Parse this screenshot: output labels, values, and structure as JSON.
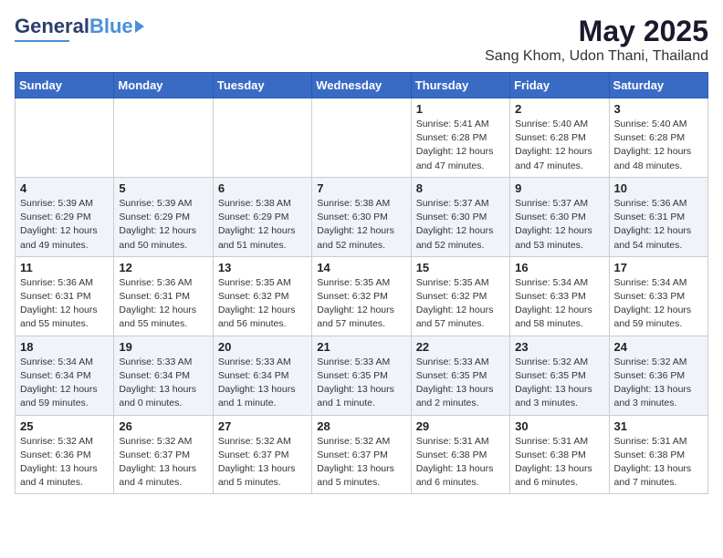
{
  "header": {
    "logo_general": "General",
    "logo_blue": "Blue",
    "title": "May 2025",
    "subtitle": "Sang Khom, Udon Thani, Thailand"
  },
  "weekdays": [
    "Sunday",
    "Monday",
    "Tuesday",
    "Wednesday",
    "Thursday",
    "Friday",
    "Saturday"
  ],
  "weeks": [
    [
      {
        "day": "",
        "info": ""
      },
      {
        "day": "",
        "info": ""
      },
      {
        "day": "",
        "info": ""
      },
      {
        "day": "",
        "info": ""
      },
      {
        "day": "1",
        "info": "Sunrise: 5:41 AM\nSunset: 6:28 PM\nDaylight: 12 hours\nand 47 minutes."
      },
      {
        "day": "2",
        "info": "Sunrise: 5:40 AM\nSunset: 6:28 PM\nDaylight: 12 hours\nand 47 minutes."
      },
      {
        "day": "3",
        "info": "Sunrise: 5:40 AM\nSunset: 6:28 PM\nDaylight: 12 hours\nand 48 minutes."
      }
    ],
    [
      {
        "day": "4",
        "info": "Sunrise: 5:39 AM\nSunset: 6:29 PM\nDaylight: 12 hours\nand 49 minutes."
      },
      {
        "day": "5",
        "info": "Sunrise: 5:39 AM\nSunset: 6:29 PM\nDaylight: 12 hours\nand 50 minutes."
      },
      {
        "day": "6",
        "info": "Sunrise: 5:38 AM\nSunset: 6:29 PM\nDaylight: 12 hours\nand 51 minutes."
      },
      {
        "day": "7",
        "info": "Sunrise: 5:38 AM\nSunset: 6:30 PM\nDaylight: 12 hours\nand 52 minutes."
      },
      {
        "day": "8",
        "info": "Sunrise: 5:37 AM\nSunset: 6:30 PM\nDaylight: 12 hours\nand 52 minutes."
      },
      {
        "day": "9",
        "info": "Sunrise: 5:37 AM\nSunset: 6:30 PM\nDaylight: 12 hours\nand 53 minutes."
      },
      {
        "day": "10",
        "info": "Sunrise: 5:36 AM\nSunset: 6:31 PM\nDaylight: 12 hours\nand 54 minutes."
      }
    ],
    [
      {
        "day": "11",
        "info": "Sunrise: 5:36 AM\nSunset: 6:31 PM\nDaylight: 12 hours\nand 55 minutes."
      },
      {
        "day": "12",
        "info": "Sunrise: 5:36 AM\nSunset: 6:31 PM\nDaylight: 12 hours\nand 55 minutes."
      },
      {
        "day": "13",
        "info": "Sunrise: 5:35 AM\nSunset: 6:32 PM\nDaylight: 12 hours\nand 56 minutes."
      },
      {
        "day": "14",
        "info": "Sunrise: 5:35 AM\nSunset: 6:32 PM\nDaylight: 12 hours\nand 57 minutes."
      },
      {
        "day": "15",
        "info": "Sunrise: 5:35 AM\nSunset: 6:32 PM\nDaylight: 12 hours\nand 57 minutes."
      },
      {
        "day": "16",
        "info": "Sunrise: 5:34 AM\nSunset: 6:33 PM\nDaylight: 12 hours\nand 58 minutes."
      },
      {
        "day": "17",
        "info": "Sunrise: 5:34 AM\nSunset: 6:33 PM\nDaylight: 12 hours\nand 59 minutes."
      }
    ],
    [
      {
        "day": "18",
        "info": "Sunrise: 5:34 AM\nSunset: 6:34 PM\nDaylight: 12 hours\nand 59 minutes."
      },
      {
        "day": "19",
        "info": "Sunrise: 5:33 AM\nSunset: 6:34 PM\nDaylight: 13 hours\nand 0 minutes."
      },
      {
        "day": "20",
        "info": "Sunrise: 5:33 AM\nSunset: 6:34 PM\nDaylight: 13 hours\nand 1 minute."
      },
      {
        "day": "21",
        "info": "Sunrise: 5:33 AM\nSunset: 6:35 PM\nDaylight: 13 hours\nand 1 minute."
      },
      {
        "day": "22",
        "info": "Sunrise: 5:33 AM\nSunset: 6:35 PM\nDaylight: 13 hours\nand 2 minutes."
      },
      {
        "day": "23",
        "info": "Sunrise: 5:32 AM\nSunset: 6:35 PM\nDaylight: 13 hours\nand 3 minutes."
      },
      {
        "day": "24",
        "info": "Sunrise: 5:32 AM\nSunset: 6:36 PM\nDaylight: 13 hours\nand 3 minutes."
      }
    ],
    [
      {
        "day": "25",
        "info": "Sunrise: 5:32 AM\nSunset: 6:36 PM\nDaylight: 13 hours\nand 4 minutes."
      },
      {
        "day": "26",
        "info": "Sunrise: 5:32 AM\nSunset: 6:37 PM\nDaylight: 13 hours\nand 4 minutes."
      },
      {
        "day": "27",
        "info": "Sunrise: 5:32 AM\nSunset: 6:37 PM\nDaylight: 13 hours\nand 5 minutes."
      },
      {
        "day": "28",
        "info": "Sunrise: 5:32 AM\nSunset: 6:37 PM\nDaylight: 13 hours\nand 5 minutes."
      },
      {
        "day": "29",
        "info": "Sunrise: 5:31 AM\nSunset: 6:38 PM\nDaylight: 13 hours\nand 6 minutes."
      },
      {
        "day": "30",
        "info": "Sunrise: 5:31 AM\nSunset: 6:38 PM\nDaylight: 13 hours\nand 6 minutes."
      },
      {
        "day": "31",
        "info": "Sunrise: 5:31 AM\nSunset: 6:38 PM\nDaylight: 13 hours\nand 7 minutes."
      }
    ]
  ]
}
